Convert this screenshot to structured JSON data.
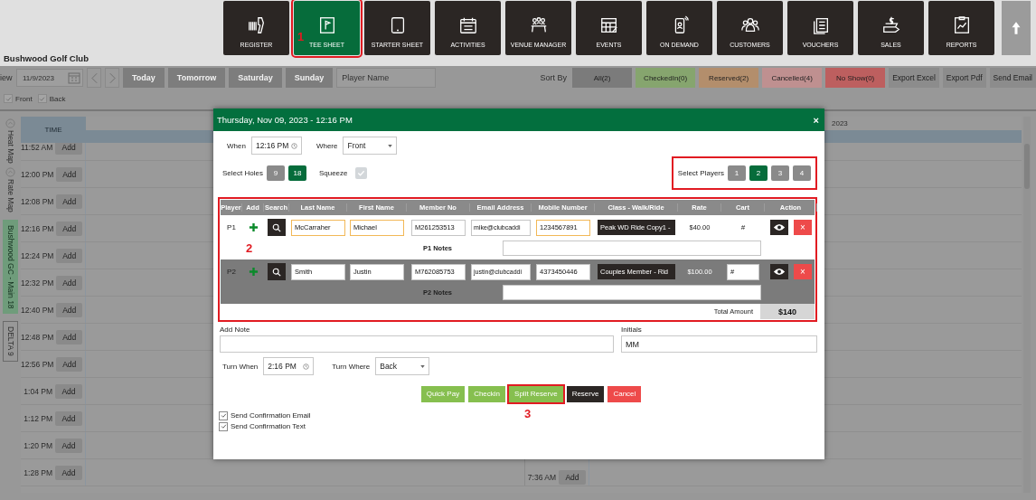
{
  "header": {
    "club_name": "Bushwood Golf Club",
    "nav": [
      {
        "label": "REGISTER",
        "selected": false,
        "highlighted": false
      },
      {
        "label": "TEE SHEET",
        "selected": true,
        "highlighted": true,
        "annotation": "1"
      },
      {
        "label": "STARTER SHEET",
        "selected": false,
        "highlighted": false
      },
      {
        "label": "ACTIVITIES",
        "selected": false,
        "highlighted": false
      },
      {
        "label": "VENUE MANAGER",
        "selected": false,
        "highlighted": false
      },
      {
        "label": "EVENTS",
        "selected": false,
        "highlighted": false
      },
      {
        "label": "ON DEMAND",
        "selected": false,
        "highlighted": false
      },
      {
        "label": "CUSTOMERS",
        "selected": false,
        "highlighted": false
      },
      {
        "label": "VOUCHERS",
        "selected": false,
        "highlighted": false
      },
      {
        "label": "SALES",
        "selected": false,
        "highlighted": false
      },
      {
        "label": "REPORTS",
        "selected": false,
        "highlighted": false
      }
    ]
  },
  "toolbar": {
    "view_label": "iew",
    "date": "11/9/2023",
    "day_buttons": [
      "Today",
      "Tomorrow",
      "Saturday",
      "Sunday"
    ],
    "player_search": {
      "placeholder": "Player Name"
    },
    "sort_label": "Sort By",
    "filters": [
      {
        "label": "All(2)",
        "color": "#7b7b7b"
      },
      {
        "label": "CheckedIn(0)",
        "color": "#86a56e"
      },
      {
        "label": "Reserved(2)",
        "color": "#b38e6c"
      },
      {
        "label": "Cancelled(4)",
        "color": "#bf9090"
      },
      {
        "label": "No Show(0)",
        "color": "#bd5f5f"
      }
    ],
    "exports": [
      "Export Excel",
      "Export Pdf",
      "Send Email"
    ]
  },
  "course_filters": [
    {
      "label": "Front",
      "checked": true
    },
    {
      "label": "Back",
      "checked": true
    }
  ],
  "side_toggles": [
    "Heat Map",
    "Rate Map"
  ],
  "courses": [
    {
      "label": "Bushwood GC - Main 18",
      "selected": true
    },
    {
      "label": "DELTA 9",
      "selected": false
    }
  ],
  "tee_sheet": {
    "time_header": "TIME",
    "date_header": "2023",
    "slots": [
      {
        "time": "11:52 AM",
        "action": "Add"
      },
      {
        "time": "12:00 PM",
        "action": "Add"
      },
      {
        "time": "12:08 PM",
        "action": "Add"
      },
      {
        "time": "12:16 PM",
        "action": "Add"
      },
      {
        "time": "12:24 PM",
        "action": "Add"
      },
      {
        "time": "12:32 PM",
        "action": "Add"
      },
      {
        "time": "12:40 PM",
        "action": "Add"
      },
      {
        "time": "12:48 PM",
        "action": "Add"
      },
      {
        "time": "12:56 PM",
        "action": "Add"
      },
      {
        "time": "1:04 PM",
        "action": "Add"
      },
      {
        "time": "1:12 PM",
        "action": "Add"
      },
      {
        "time": "1:20 PM",
        "action": "Add"
      },
      {
        "time": "1:28 PM",
        "action": "Add"
      }
    ],
    "back_slots": [
      {
        "time": "7:36 AM",
        "action": "Add"
      }
    ]
  },
  "modal": {
    "title": "Thursday, Nov 09, 2023 - 12:16 PM",
    "close": "×",
    "when": {
      "label": "When",
      "value": "12:16 PM"
    },
    "where": {
      "label": "Where",
      "value": "Front"
    },
    "holes": {
      "label": "Select Holes",
      "options": [
        {
          "label": "9",
          "selected": false
        },
        {
          "label": "18",
          "selected": true
        }
      ]
    },
    "squeeze": {
      "label": "Squeeze",
      "checked": true
    },
    "players_select": {
      "label": "Select Players",
      "highlighted": true,
      "options": [
        {
          "label": "1",
          "selected": false
        },
        {
          "label": "2",
          "selected": true
        },
        {
          "label": "3",
          "selected": false
        },
        {
          "label": "4",
          "selected": false
        }
      ]
    },
    "table": {
      "highlighted": true,
      "annotation": "2",
      "columns": [
        "Player",
        "Add",
        "Search",
        "Last Name",
        "First Name",
        "Member No",
        "Email Address",
        "Mobile Number",
        "Class - Walk/Ride",
        "Rate",
        "Cart",
        "Action"
      ],
      "rows": [
        {
          "player": "P1",
          "selected": false,
          "last_name": {
            "value": "McCarraher",
            "flagged": true
          },
          "first_name": {
            "value": "Michael",
            "flagged": true
          },
          "member_no": {
            "value": "M261253513",
            "flagged": false
          },
          "email": {
            "value": "mike@clubcaddi",
            "flagged": false
          },
          "mobile": {
            "value": "1234567891",
            "flagged": true
          },
          "class": "Peak WD Ride Copy1 -",
          "rate": "$40.00",
          "cart": {
            "value": "#",
            "kind": "text"
          },
          "notes_label": "P1 Notes",
          "remove": "×"
        },
        {
          "player": "P2",
          "selected": true,
          "last_name": {
            "value": "Smith",
            "flagged": false
          },
          "first_name": {
            "value": "Justin",
            "flagged": false
          },
          "member_no": {
            "value": "M762085753",
            "flagged": false
          },
          "email": {
            "value": "justin@clubcaddi",
            "flagged": false
          },
          "mobile": {
            "value": "4373450446",
            "flagged": false
          },
          "class": "Couples Member - Rid",
          "rate": "$100.00",
          "cart": {
            "value": "#",
            "kind": "input"
          },
          "notes_label": "P2 Notes",
          "remove": "×"
        }
      ],
      "total": {
        "label": "Total Amount",
        "value": "$140"
      }
    },
    "add_note": {
      "label": "Add Note"
    },
    "initials": {
      "label": "Initials",
      "value": "MM"
    },
    "turn_when": {
      "label": "Turn When",
      "value": "2:16 PM"
    },
    "turn_where": {
      "label": "Turn Where",
      "value": "Back"
    },
    "actions": [
      {
        "label": "Quick Pay",
        "kind": "light",
        "highlighted": false
      },
      {
        "label": "Checkin",
        "kind": "light",
        "highlighted": false
      },
      {
        "label": "Split Reserve",
        "kind": "light",
        "highlighted": true,
        "annotation": "3"
      },
      {
        "label": "Reserve",
        "kind": "dark",
        "highlighted": false
      },
      {
        "label": "Cancel",
        "kind": "danger",
        "highlighted": false
      }
    ],
    "confirmations": [
      {
        "label": "Send Confirmation Email",
        "checked": true
      },
      {
        "label": "Send Confirmation Text",
        "checked": true
      }
    ]
  }
}
